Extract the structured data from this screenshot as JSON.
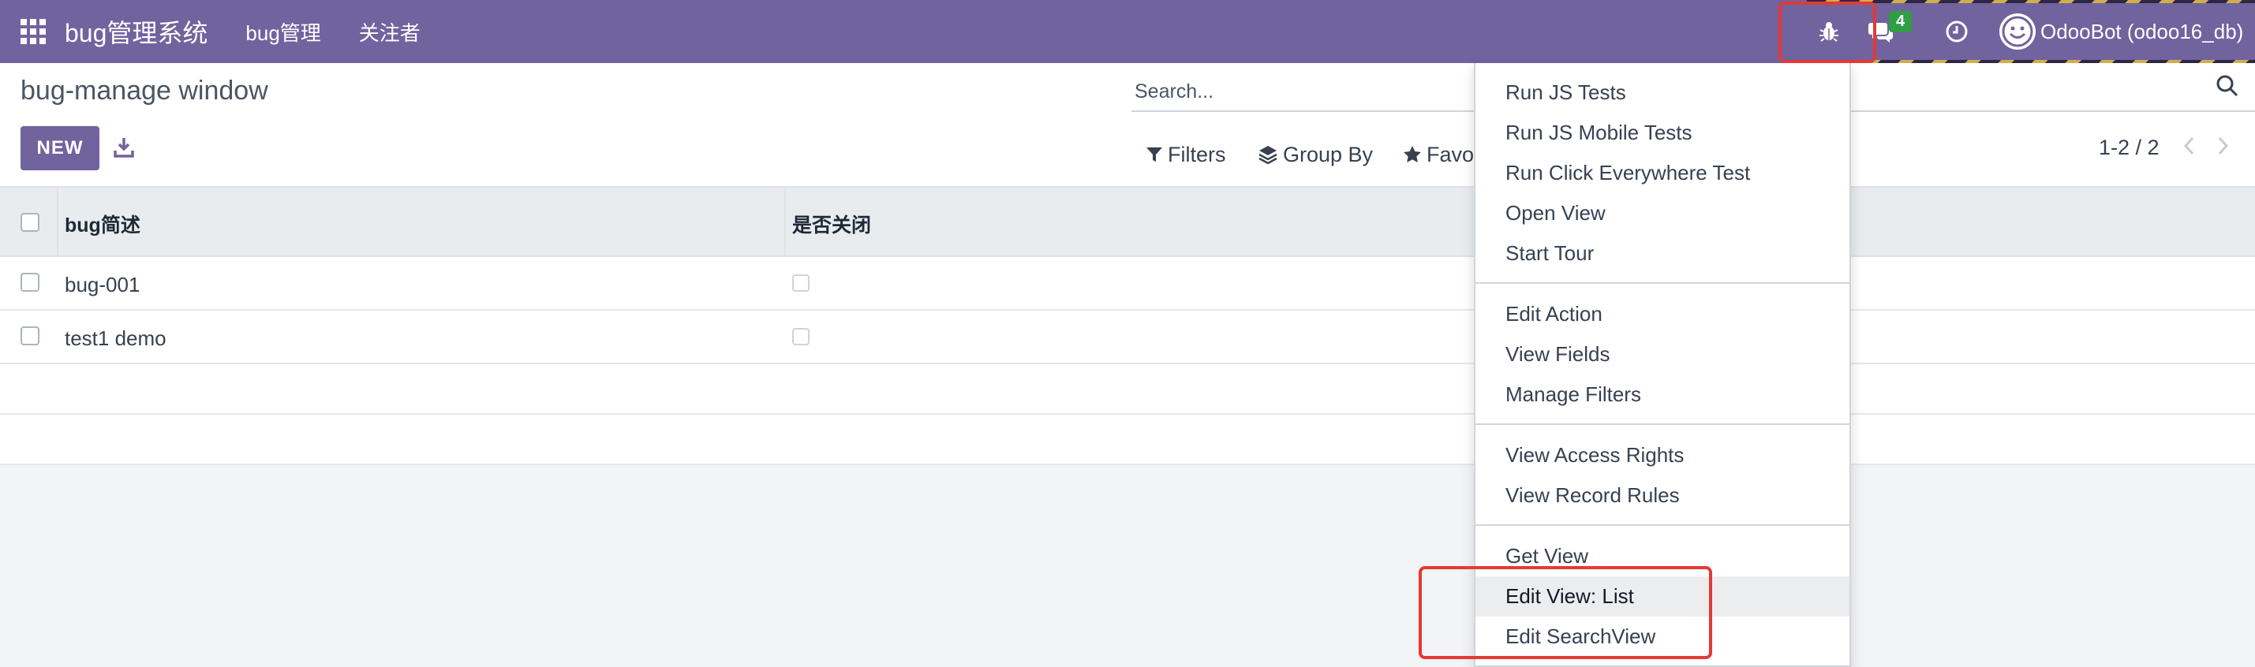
{
  "navbar": {
    "brand": "bug管理系统",
    "menu": [
      "bug管理",
      "关注者"
    ],
    "message_count": "4",
    "user_label": "OdooBot (odoo16_db)"
  },
  "control_panel": {
    "title": "bug-manage window",
    "new_label": "NEW",
    "search_placeholder": "Search...",
    "filters_label": "Filters",
    "group_by_label": "Group By",
    "favorites_label": "Favo",
    "pager": "1-2 / 2"
  },
  "list": {
    "columns": [
      "bug简述",
      "是否关闭"
    ],
    "rows": [
      {
        "name": "bug-001",
        "closed": false
      },
      {
        "name": "test1 demo",
        "closed": false
      }
    ]
  },
  "debug_menu": {
    "groups": [
      [
        "Run JS Tests",
        "Run JS Mobile Tests",
        "Run Click Everywhere Test",
        "Open View",
        "Start Tour"
      ],
      [
        "Edit Action",
        "View Fields",
        "Manage Filters"
      ],
      [
        "View Access Rights",
        "View Record Rules"
      ],
      [
        "Get View",
        "Edit View: List",
        "Edit SearchView"
      ]
    ],
    "active_item": "Edit View: List"
  },
  "colors": {
    "brand": "#71639e",
    "highlight_box": "#e53935",
    "badge": "#2f9e44"
  },
  "icons": [
    "apps-icon",
    "bug-icon",
    "chat-icon",
    "clock-icon",
    "download-icon",
    "search-icon",
    "filter-icon",
    "layers-icon",
    "star-icon",
    "chevron-left-icon",
    "chevron-right-icon"
  ]
}
